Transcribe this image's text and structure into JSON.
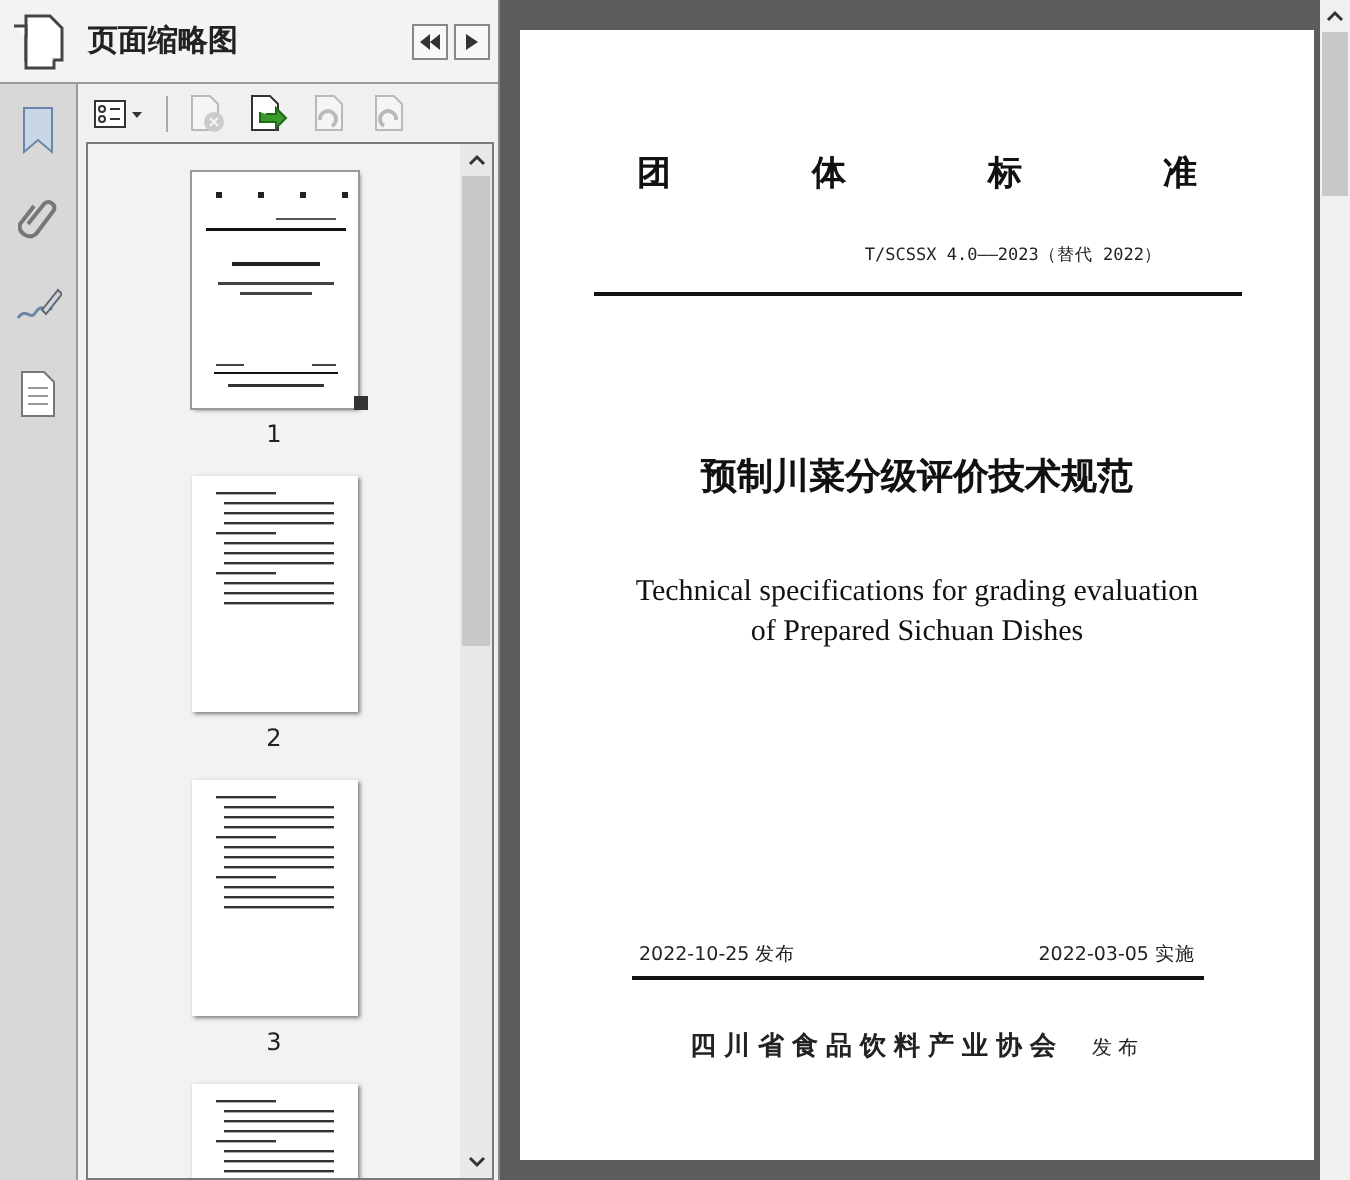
{
  "panel": {
    "title": "页面缩略图"
  },
  "toolbar": [
    {
      "kind": "options",
      "disabled": false
    },
    {
      "kind": "delete",
      "disabled": true
    },
    {
      "kind": "insert",
      "disabled": false
    },
    {
      "kind": "undo",
      "disabled": true
    },
    {
      "kind": "redo",
      "disabled": true
    }
  ],
  "thumbnails": [
    {
      "kind": "cover",
      "label": "1",
      "selected": true
    },
    {
      "kind": "text",
      "label": "2",
      "selected": false
    },
    {
      "kind": "text",
      "label": "3",
      "selected": false
    },
    {
      "kind": "text",
      "selected": false
    }
  ],
  "document": {
    "heading_chars": [
      "团",
      "体",
      "标",
      "准"
    ],
    "code": "T/SCSSX 4.0——2023（替代 2022）",
    "title": "预制川菜分级评价技术规范",
    "english_title": [
      "Technical specifications for grading evaluation",
      "of Prepared Sichuan Dishes"
    ],
    "publish_date": "2022-10-25 发布",
    "effective_date": "2022-03-05 实施",
    "organization": "四川省食品饮料产业协会",
    "organization_suffix": "发布"
  }
}
